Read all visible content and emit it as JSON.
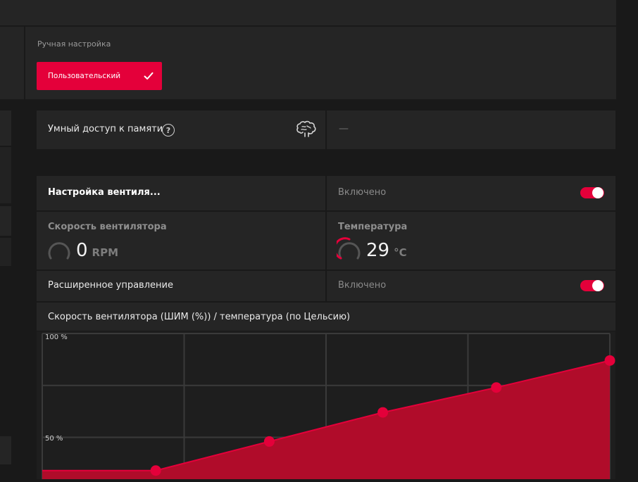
{
  "manual": {
    "label": "Ручная настройка",
    "profile_button": "Пользовательский"
  },
  "memory": {
    "title": "Умный доступ к памяти",
    "value": "—"
  },
  "fan_tuning": {
    "title": "Настройка вентиля...",
    "state": "Включено",
    "enabled": true
  },
  "fan_speed": {
    "label": "Скорость вентилятора",
    "value": "0",
    "unit": "RPM"
  },
  "temperature": {
    "label": "Температура",
    "value": "29",
    "unit": "°C"
  },
  "advanced": {
    "title": "Расширенное управление",
    "state": "Включено",
    "enabled": true
  },
  "chart_title": "Скорость вентилятора (ШИМ (%)) / температура (по Цельсию)",
  "colors": {
    "accent": "#e4003a",
    "fill": "#b00c2a",
    "panel": "#252525"
  },
  "chart_data": {
    "type": "area",
    "ylabel_ticks": [
      "100 %",
      "50 %"
    ],
    "y_ticks": [
      100,
      50
    ],
    "ylim": [
      0,
      100
    ],
    "x": [
      0,
      1,
      2,
      3,
      4,
      5
    ],
    "xlim": [
      0,
      5
    ],
    "series": [
      {
        "values": [
          34,
          34,
          48,
          62,
          74,
          87
        ]
      }
    ],
    "control_point_indices": [
      1,
      2,
      3,
      4,
      5
    ],
    "grid": true
  }
}
